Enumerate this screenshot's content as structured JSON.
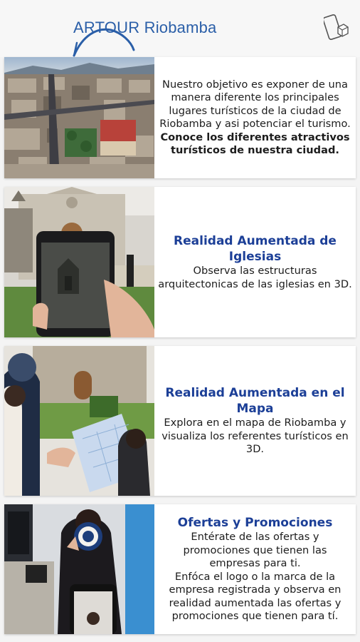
{
  "app_bar": {
    "title": "ARTOUR Riobamba",
    "ar_icon": "ar-cube-phone-icon"
  },
  "cards": [
    {
      "image": "riobamba-aerial-city-photo",
      "lines": [
        "Nuestro objetivo es exponer de una",
        "manera diferente los principales",
        "lugares turísticos de la ciudad de",
        "Riobamba y asi potenciar el turismo."
      ],
      "bold_lines": [
        "Conoce los diferentes atractivos",
        "turísticos de nuestra ciudad."
      ]
    },
    {
      "image": "phone-ar-church-photo",
      "heading_lines": [
        "Realidad Aumentada de",
        "Iglesias"
      ],
      "lines": [
        "Observa las estructuras",
        "arquitectonicas de las iglesias en 3D."
      ]
    },
    {
      "image": "people-with-map-photo",
      "heading_lines": [
        "Realidad Aumentada en el",
        "Mapa"
      ],
      "lines": [
        "Explora en el mapa de Riobamba y",
        "visualiza los referentes turísticos en",
        "3D."
      ]
    },
    {
      "image": "phone-scanning-logo-photo",
      "heading_lines": [
        "Ofertas y Promociones"
      ],
      "lines": [
        "Entérate de las ofertas y",
        "promociones que tienen las",
        "empresas para ti.",
        "Enfóca el logo o la marca de la",
        "empresa registrada y observa en",
        "realidad aumentada las ofertas y",
        "promociones que tienen para tí."
      ]
    }
  ]
}
